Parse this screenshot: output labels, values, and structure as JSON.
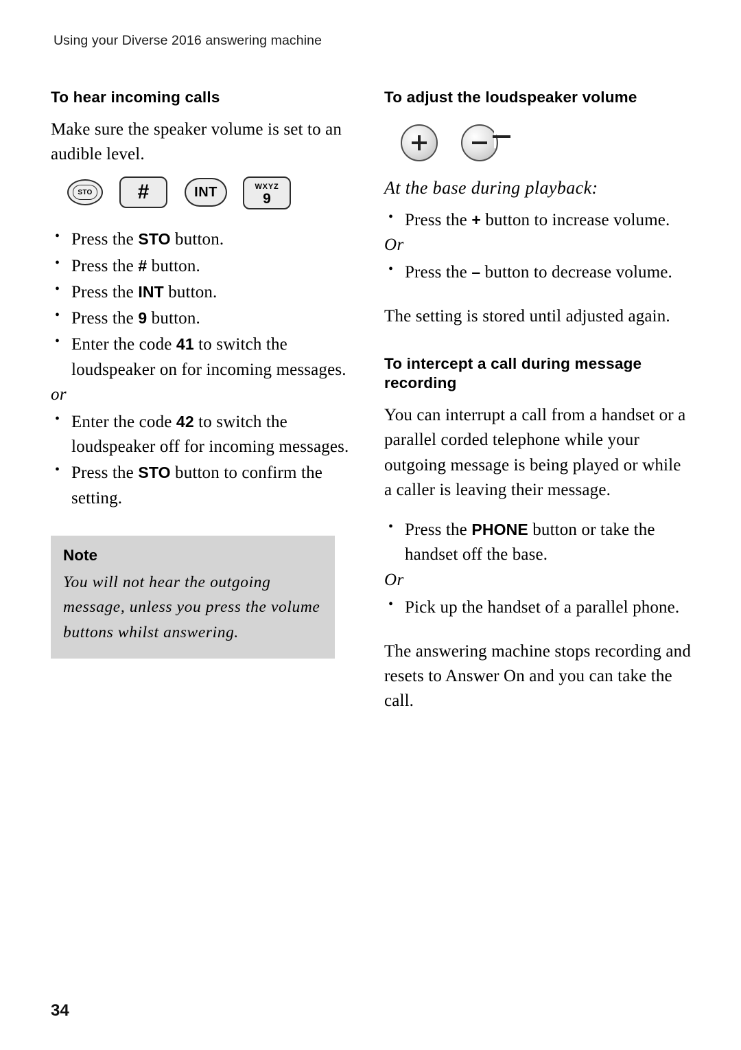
{
  "header": {
    "running_head": "Using your Diverse 2016 answering machine"
  },
  "left_column": {
    "section_title": "To hear incoming calls",
    "intro": "Make sure the speaker volume is set to an audible level.",
    "keys": [
      {
        "name": "sto-key",
        "label": "STO"
      },
      {
        "name": "hash-key",
        "label": "#"
      },
      {
        "name": "int-key",
        "label": "INT"
      },
      {
        "name": "nine-key",
        "label_top": "WXYZ",
        "label_main": "9"
      }
    ],
    "steps": [
      {
        "pre": "Press the ",
        "key": "STO",
        "post": " button."
      },
      {
        "pre": "Press the ",
        "key": "#",
        "post": " button."
      },
      {
        "pre": "Press the ",
        "key": "INT",
        "post": " button."
      },
      {
        "pre": "Press the ",
        "key": "9",
        "post": " button."
      },
      {
        "pre": "Enter the code ",
        "key": "41",
        "post": " to switch the loudspeaker on for incoming messages."
      }
    ],
    "or_divider": "or",
    "steps2": [
      {
        "pre": "Enter the code ",
        "key": "42",
        "post": " to switch the loudspeaker off for incoming messages."
      },
      {
        "pre": "Press the ",
        "key": "STO",
        "post": " button to confirm the setting."
      }
    ],
    "note": {
      "title": "Note",
      "body": "You will not hear the outgoing message, unless you press the volume buttons whilst answering."
    }
  },
  "right_column": {
    "section_title": "To adjust the loudspeaker volume",
    "vol_buttons": [
      {
        "name": "volume-up-button",
        "symbol": "+"
      },
      {
        "name": "volume-down-button",
        "symbol": "–"
      }
    ],
    "subtitle": "At the base during playback:",
    "steps": [
      {
        "pre": "Press the ",
        "key": "+",
        "post": " button to increase volume."
      }
    ],
    "or_divider": "Or",
    "steps2": [
      {
        "pre": "Press the ",
        "key": "–",
        "post": " button to decrease volume."
      }
    ],
    "stored_text": "The setting is stored until adjusted again.",
    "section_title2": "To intercept a call during message recording",
    "intercept_text": "You can interrupt a call from a handset or a parallel corded telephone while your outgoing message is being played or while a caller is leaving their message.",
    "intercept_steps": [
      {
        "pre": "Press the ",
        "key": "PHONE",
        "post": " button or take the handset off the base."
      }
    ],
    "or_divider2": "Or",
    "intercept_steps2": [
      {
        "pre": "Pick up the handset of a parallel phone.",
        "key": "",
        "post": ""
      }
    ],
    "closing_text": "The answering machine stops recording and resets to Answer On and you can take the call."
  },
  "footer": {
    "page_number": "34"
  }
}
